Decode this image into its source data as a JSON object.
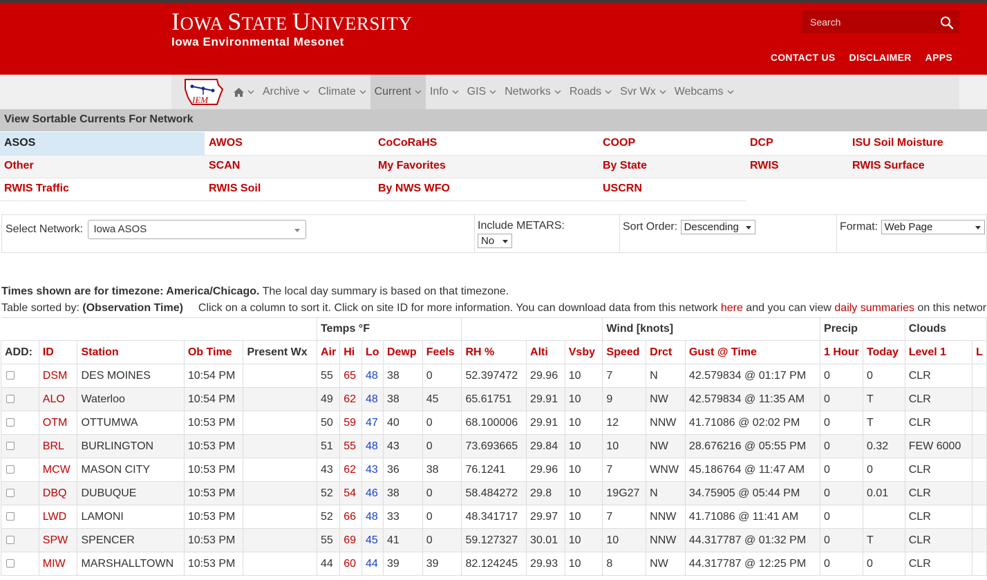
{
  "header": {
    "university": "Iowa State University",
    "univ_i": "I",
    "univ_owa": "OWA",
    "univ_s": "S",
    "univ_tate": "TATE",
    "univ_u": "U",
    "univ_niversity": "NIVERSITY",
    "subtitle": "Iowa Environmental Mesonet",
    "search_placeholder": "Search",
    "links": [
      "CONTACT US",
      "DISCLAIMER",
      "APPS"
    ]
  },
  "nav": {
    "logo_text": "IEM",
    "items": [
      "Archive",
      "Climate",
      "Current",
      "Info",
      "GIS",
      "Networks",
      "Roads",
      "Svr Wx",
      "Webcams"
    ],
    "active": "Current"
  },
  "section_title": "View Sortable Currents For Network",
  "networks": [
    [
      "ASOS",
      "AWOS",
      "CoCoRaHS",
      "COOP",
      "DCP",
      "ISU Soil Moisture"
    ],
    [
      "Other",
      "SCAN",
      "My Favorites",
      "By State",
      "RWIS",
      "RWIS Surface"
    ],
    [
      "RWIS Traffic",
      "RWIS Soil",
      "By NWS WFO",
      "USCRN"
    ]
  ],
  "selected_network": "ASOS",
  "filters": {
    "network_label": "Select Network:",
    "network_value": "Iowa ASOS",
    "metars_label": "Include METARS:",
    "metars_value": "No",
    "order_label": "Sort Order:",
    "order_value": "Descending",
    "format_label": "Format:",
    "format_value": "Web Page"
  },
  "info": {
    "tz_bold": "Times shown are for timezone: America/Chicago.",
    "tz_rest": " The local day summary is based on that timezone.",
    "sorted_label": "Table sorted by: ",
    "sorted_value": "(Observation Time)",
    "text1": "Click on a column to sort it. Click on site ID for more information. You can download data from this network ",
    "link1": "here",
    "text2": " and you can view ",
    "link2": "daily summaries",
    "text3": " on this network"
  },
  "table": {
    "groups": {
      "temps": "Temps °F",
      "wind": "Wind [knots]",
      "precip": "Precip",
      "clouds": "Clouds"
    },
    "columns": [
      "ADD:",
      "ID",
      "Station",
      "Ob Time",
      "Present Wx",
      "Air",
      "Hi",
      "Lo",
      "Dewp",
      "Feels",
      "RH %",
      "Alti",
      "Vsby",
      "Speed",
      "Drct",
      "Gust @ Time",
      "1 Hour",
      "Today",
      "Level 1",
      "L"
    ],
    "rows": [
      [
        "DSM",
        "DES MOINES",
        "10:54 PM",
        "",
        "55",
        "65",
        "48",
        "38",
        "0",
        "52.397472",
        "29.96",
        "10",
        "7",
        "N",
        "42.579834 @ 01:17 PM",
        "0",
        "0",
        "CLR"
      ],
      [
        "ALO",
        "Waterloo",
        "10:54 PM",
        "",
        "49",
        "62",
        "48",
        "38",
        "45",
        "65.61751",
        "29.91",
        "10",
        "9",
        "NW",
        "42.579834 @ 11:35 AM",
        "0",
        "T",
        "CLR"
      ],
      [
        "OTM",
        "OTTUMWA",
        "10:53 PM",
        "",
        "50",
        "59",
        "47",
        "40",
        "0",
        "68.100006",
        "29.91",
        "10",
        "12",
        "NNW",
        "41.71086 @ 02:02 PM",
        "0",
        "T",
        "CLR"
      ],
      [
        "BRL",
        "BURLINGTON",
        "10:53 PM",
        "",
        "51",
        "55",
        "48",
        "43",
        "0",
        "73.693665",
        "29.84",
        "10",
        "10",
        "NW",
        "28.676216 @ 05:55 PM",
        "0",
        "0.32",
        "FEW 6000"
      ],
      [
        "MCW",
        "MASON CITY",
        "10:53 PM",
        "",
        "43",
        "62",
        "43",
        "36",
        "38",
        "76.1241",
        "29.96",
        "10",
        "7",
        "WNW",
        "45.186764 @ 11:47 AM",
        "0",
        "0",
        "CLR"
      ],
      [
        "DBQ",
        "DUBUQUE",
        "10:53 PM",
        "",
        "52",
        "54",
        "46",
        "38",
        "0",
        "58.484272",
        "29.8",
        "10",
        "19G27",
        "N",
        "34.75905 @ 05:44 PM",
        "0",
        "0.01",
        "CLR"
      ],
      [
        "LWD",
        "LAMONI",
        "10:53 PM",
        "",
        "52",
        "66",
        "48",
        "33",
        "0",
        "48.341717",
        "29.97",
        "10",
        "7",
        "NNW",
        "41.71086 @ 11:41 AM",
        "0",
        "",
        "CLR"
      ],
      [
        "SPW",
        "SPENCER",
        "10:53 PM",
        "",
        "55",
        "69",
        "45",
        "41",
        "0",
        "59.127327",
        "30.01",
        "10",
        "10",
        "NNW",
        "44.317787 @ 01:32 PM",
        "0",
        "T",
        "CLR"
      ],
      [
        "MIW",
        "MARSHALLTOWN",
        "10:53 PM",
        "",
        "44",
        "60",
        "44",
        "39",
        "39",
        "82.124245",
        "29.93",
        "10",
        "8",
        "NW",
        "44.317787 @ 12:25 PM",
        "0",
        "0",
        "CLR"
      ]
    ]
  },
  "colors": {
    "brand_red": "#cc0000",
    "link_red": "#c00000",
    "lo_blue": "#1a3fcf",
    "selected_bg": "#d6e9f5"
  }
}
